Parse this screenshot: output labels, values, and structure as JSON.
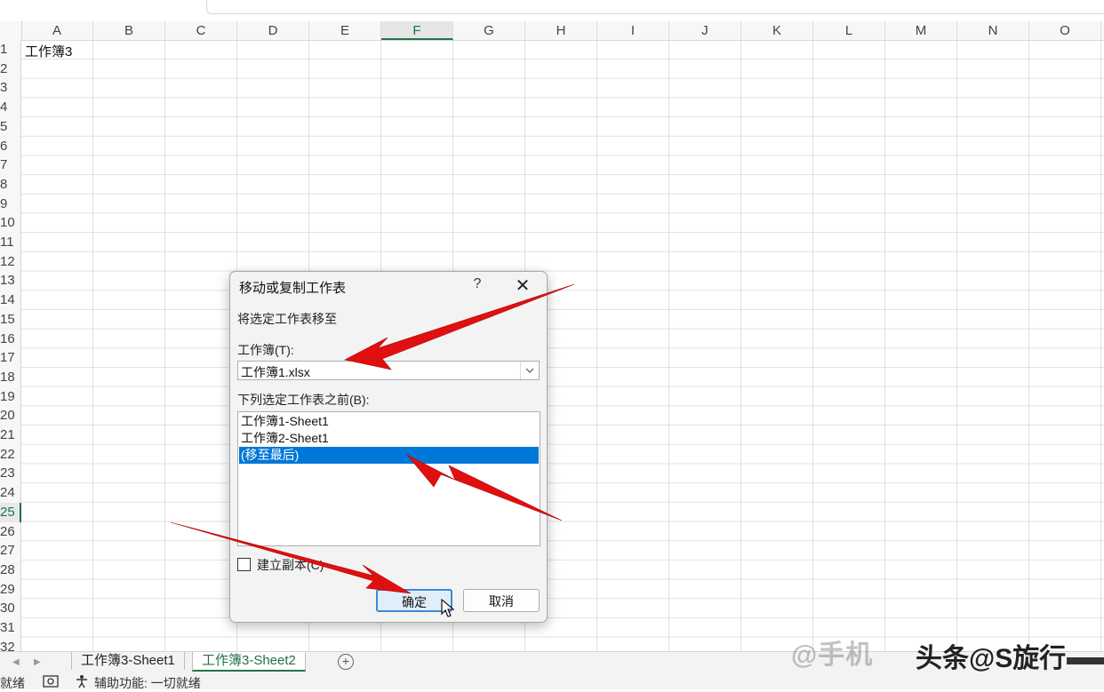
{
  "sheet": {
    "columns": [
      "A",
      "B",
      "C",
      "D",
      "E",
      "F",
      "G",
      "H",
      "I",
      "J",
      "K",
      "L",
      "M",
      "N",
      "O"
    ],
    "selected_column": "F",
    "rows": [
      "1",
      "2",
      "3",
      "4",
      "5",
      "6",
      "7",
      "8",
      "9",
      "10",
      "11",
      "12",
      "13",
      "14",
      "15",
      "16",
      "17",
      "18",
      "19",
      "20",
      "21",
      "22",
      "23",
      "24",
      "25",
      "26",
      "27",
      "28",
      "29",
      "30",
      "31",
      "32"
    ],
    "selected_row": "25",
    "cell_a1": "工作簿3"
  },
  "tabs": [
    {
      "label": "工作簿3-Sheet1",
      "active": false
    },
    {
      "label": "工作簿3-Sheet2",
      "active": true
    }
  ],
  "add_sheet": "+",
  "status": {
    "ready": "就绪",
    "accessibility": "辅助功能: 一切就绪"
  },
  "dialog": {
    "title": "移动或复制工作表",
    "help": "?",
    "close": "✕",
    "move_to_label": "将选定工作表移至",
    "workbook_label": "工作簿(T):",
    "workbook_value": "工作簿1.xlsx",
    "before_label": "下列选定工作表之前(B):",
    "sheet_list": [
      "工作簿1-Sheet1",
      "工作簿2-Sheet1",
      "(移至最后)"
    ],
    "selected_index": 2,
    "copy_label": "建立副本(C)",
    "copy_checked": false,
    "ok_label": "确定",
    "cancel_label": "取消"
  },
  "watermark": {
    "text_faded": "@手机",
    "text_dark": "头条@S旋行"
  },
  "colors": {
    "accent": "#217346",
    "selection": "#0078d7",
    "arrow": "#e01010"
  }
}
